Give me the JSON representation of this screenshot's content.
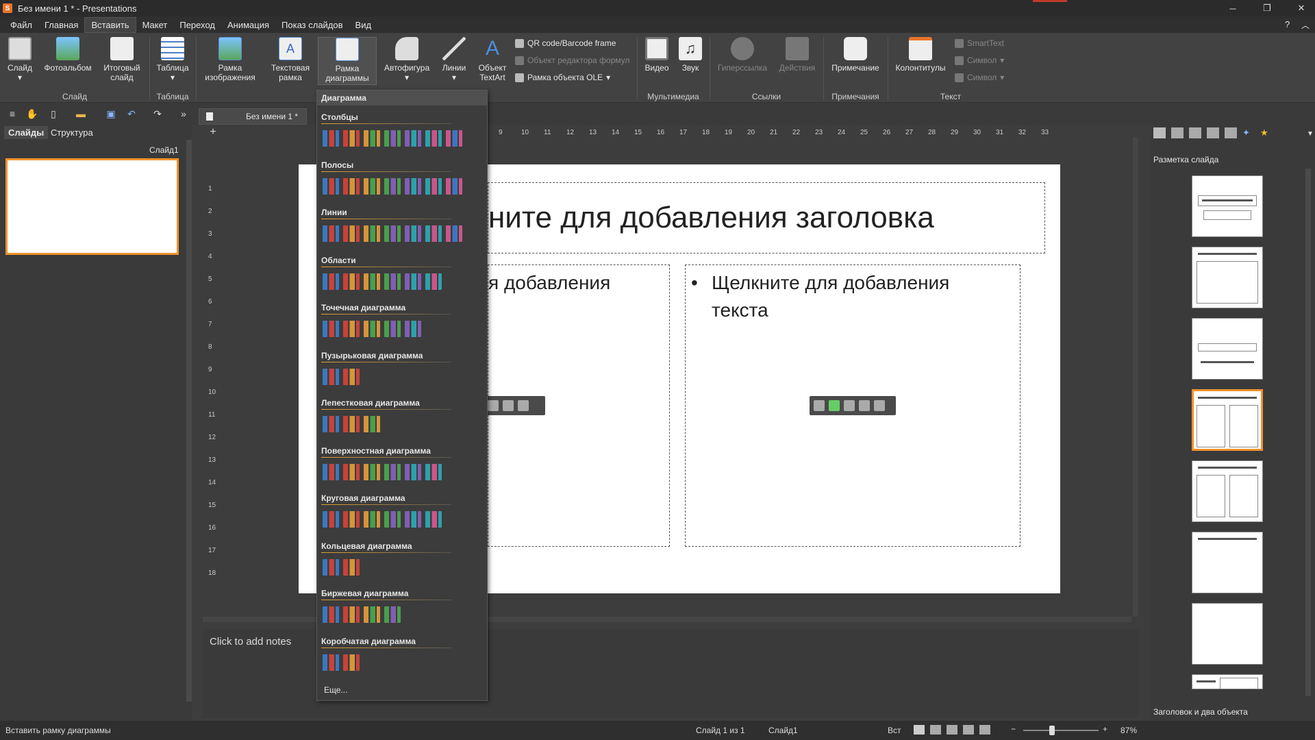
{
  "window": {
    "title": "Без имени 1 * - Presentations",
    "app_icon_letter": "S"
  },
  "menu": [
    "Файл",
    "Главная",
    "Вставить",
    "Макет",
    "Переход",
    "Анимация",
    "Показ слайдов",
    "Вид"
  ],
  "menu_active": "Вставить",
  "ribbon": {
    "buttons": {
      "slide": "Слайд",
      "photoalbum": "Фотоальбом",
      "summary_1": "Итоговый",
      "summary_2": "слайд",
      "table": "Таблица",
      "image_frame_1": "Рамка",
      "image_frame_2": "изображения",
      "text_frame_1": "Текстовая",
      "text_frame_2": "рамка",
      "chart_frame_1": "Рамка",
      "chart_frame_2": "диаграммы",
      "autoshape": "Автофигура",
      "lines": "Линии",
      "textart_1": "Объект",
      "textart_2": "TextArt",
      "qr": "QR code/Barcode frame",
      "formula": "Объект редактора формул",
      "ole": "Рамка объекта OLE",
      "video": "Видео",
      "sound": "Звук",
      "hyperlink": "Гиперссылка",
      "actions": "Действия",
      "comment": "Примечание",
      "headers": "Колонтитулы",
      "smarttext": "SmartText",
      "symbol1": "Символ",
      "symbol2": "Символ"
    },
    "groups": {
      "slide": "Слайд",
      "table": "Таблица",
      "multimedia": "Мультимедиа",
      "links": "Ссылки",
      "comments": "Примечания",
      "text": "Текст"
    }
  },
  "doc_tab": "Без имени 1 *",
  "left_panel": {
    "tab_slides": "Слайды",
    "tab_structure": "Структура",
    "slide_label": "Слайд1"
  },
  "ruler": {
    "h_ticks": [
      "9",
      "10",
      "11",
      "12",
      "13",
      "14",
      "15",
      "16",
      "17",
      "18",
      "19",
      "20",
      "21",
      "22",
      "23",
      "24",
      "25",
      "26",
      "27",
      "28",
      "29",
      "30",
      "31",
      "32",
      "33"
    ],
    "v_ticks": [
      "1",
      "2",
      "3",
      "4",
      "5",
      "6",
      "7",
      "8",
      "9",
      "10",
      "11",
      "12",
      "13",
      "14",
      "15",
      "16",
      "17",
      "18"
    ]
  },
  "slide": {
    "title": "ните для добавления заголовка",
    "left_text": "я добавления",
    "right_bullet": "•",
    "right_text_1": "Щелкните для добавления",
    "right_text_2": "текста"
  },
  "notes": {
    "placeholder": "Click to add notes"
  },
  "right_panel": {
    "title": "Разметка слайда",
    "footer": "Заголовок и два объекта"
  },
  "dropdown": {
    "header": "Диаграмма",
    "sections": [
      {
        "name": "Столбцы",
        "count": 7
      },
      {
        "name": "Полосы",
        "count": 7
      },
      {
        "name": "Линии",
        "count": 7
      },
      {
        "name": "Области",
        "count": 6
      },
      {
        "name": "Точечная диаграмма",
        "count": 5
      },
      {
        "name": "Пузырьковая диаграмма",
        "count": 2
      },
      {
        "name": "Лепестковая диаграмма",
        "count": 3
      },
      {
        "name": "Поверхностная диаграмма",
        "count": 6
      },
      {
        "name": "Круговая диаграмма",
        "count": 6
      },
      {
        "name": "Кольцевая диаграмма",
        "count": 2
      },
      {
        "name": "Биржевая диаграмма",
        "count": 4
      },
      {
        "name": "Коробчатая диаграмма",
        "count": 2
      }
    ],
    "more": "Еще..."
  },
  "status": {
    "hint": "Вставить рамку диаграммы",
    "slide_of": "Слайд 1 из 1",
    "slide_name": "Слайд1",
    "mode": "Вст",
    "zoom": "87%"
  },
  "colors": {
    "accent": "#f0922b",
    "ribbon_bg": "#424242",
    "chart_blue": "#3b82d6",
    "chart_red": "#e0443c"
  }
}
